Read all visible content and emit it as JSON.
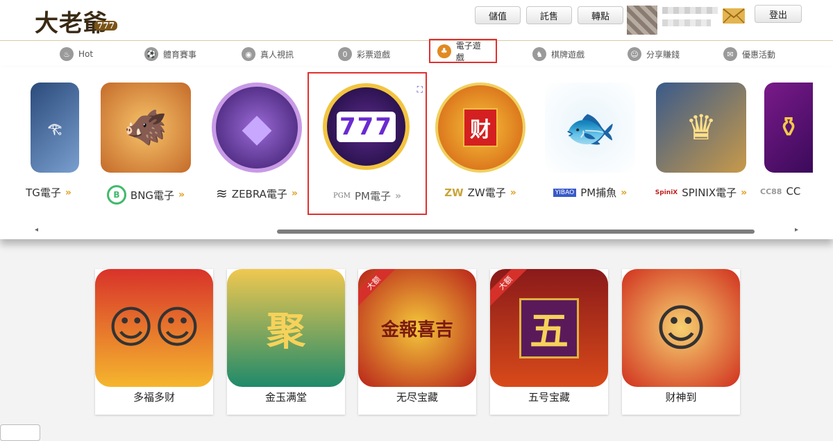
{
  "header": {
    "logo_text": "大老爺",
    "logo_num": "777",
    "buttons": {
      "deposit": "儲值",
      "sell": "託售",
      "transfer": "轉點",
      "logout": "登出"
    }
  },
  "nav": {
    "items": [
      {
        "label": "Hot",
        "icon": "flame-icon"
      },
      {
        "label": "體育賽事",
        "icon": "soccer-ball-icon"
      },
      {
        "label": "真人視訊",
        "icon": "casino-chip-icon"
      },
      {
        "label": "彩票遊戲",
        "icon": "lottery-ball-icon"
      },
      {
        "label": "電子遊戲",
        "icon": "cherry-icon",
        "active": true
      },
      {
        "label": "棋牌遊戲",
        "icon": "chess-piece-icon"
      },
      {
        "label": "分享賺錢",
        "icon": "people-icon"
      },
      {
        "label": "優惠活動",
        "icon": "gift-icon"
      }
    ]
  },
  "providers": [
    {
      "label": "TG電子"
    },
    {
      "label": "BNG電子",
      "logo": "B"
    },
    {
      "label": "ZEBRA電子",
      "logo": "zebra-icon"
    },
    {
      "label": "PM電子",
      "logo": "PGM",
      "selected": true
    },
    {
      "label": "ZW電子",
      "logo": "ZW"
    },
    {
      "label": "PM捕魚",
      "logo": "YIBAO"
    },
    {
      "label": "SPINIX電子",
      "logo": "SpiniX"
    },
    {
      "label": "CC",
      "logo": "CC88"
    }
  ],
  "games": [
    {
      "title": "多福多财",
      "badge": ""
    },
    {
      "title": "金玉满堂",
      "badge": "",
      "art_text": "聚"
    },
    {
      "title": "无尽宝藏",
      "badge": "大额",
      "art_text": "金報喜吉"
    },
    {
      "title": "五号宝藏",
      "badge": "大额",
      "art_text": "五"
    },
    {
      "title": "财神到",
      "badge": ""
    }
  ],
  "colors": {
    "accent_red": "#e03030",
    "gold": "#e0a020",
    "nav_border": "#d8c9a8"
  }
}
